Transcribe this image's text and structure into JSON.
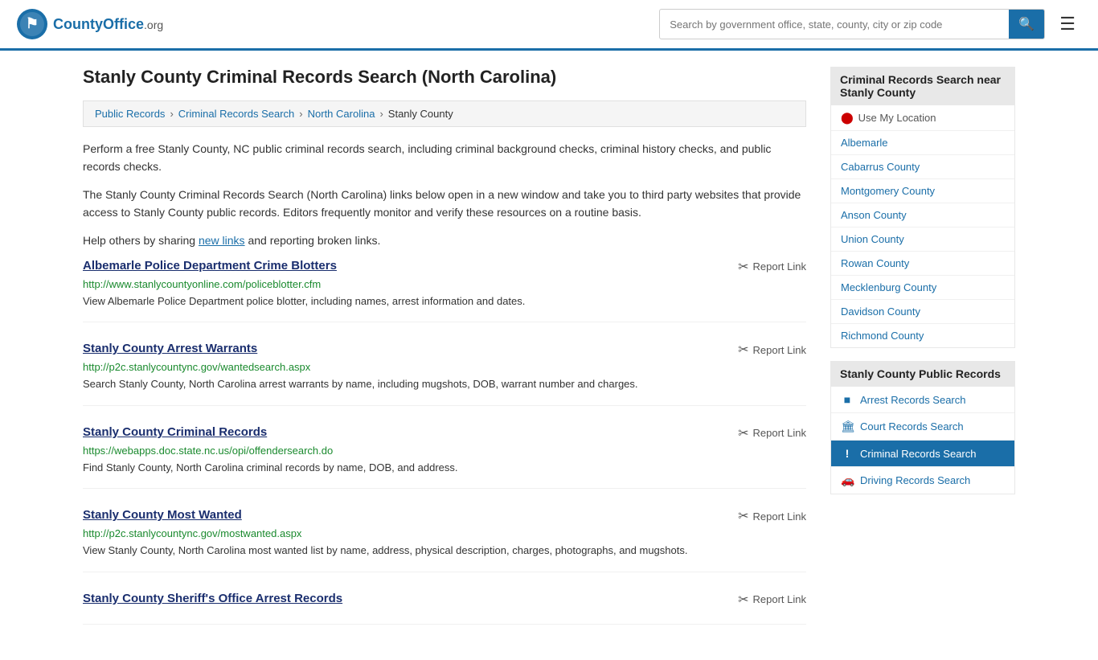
{
  "header": {
    "logo_name": "CountyOffice",
    "logo_suffix": ".org",
    "search_placeholder": "Search by government office, state, county, city or zip code"
  },
  "page": {
    "title": "Stanly County Criminal Records Search (North Carolina)"
  },
  "breadcrumb": {
    "items": [
      {
        "label": "Public Records",
        "href": "#"
      },
      {
        "label": "Criminal Records Search",
        "href": "#"
      },
      {
        "label": "North Carolina",
        "href": "#"
      },
      {
        "label": "Stanly County",
        "href": "#"
      }
    ]
  },
  "description": {
    "para1": "Perform a free Stanly County, NC public criminal records search, including criminal background checks, criminal history checks, and public records checks.",
    "para2": "The Stanly County Criminal Records Search (North Carolina) links below open in a new window and take you to third party websites that provide access to Stanly County public records. Editors frequently monitor and verify these resources on a routine basis.",
    "para3_start": "Help others by sharing ",
    "para3_link": "new links",
    "para3_end": " and reporting broken links."
  },
  "results": [
    {
      "title": "Albemarle Police Department Crime Blotters",
      "url": "http://www.stanlycountyonline.com/policeblotter.cfm",
      "description": "View Albemarle Police Department police blotter, including names, arrest information and dates.",
      "report_label": "Report Link"
    },
    {
      "title": "Stanly County Arrest Warrants",
      "url": "http://p2c.stanlycountync.gov/wantedsearch.aspx",
      "description": "Search Stanly County, North Carolina arrest warrants by name, including mugshots, DOB, warrant number and charges.",
      "report_label": "Report Link"
    },
    {
      "title": "Stanly County Criminal Records",
      "url": "https://webapps.doc.state.nc.us/opi/offendersearch.do",
      "description": "Find Stanly County, North Carolina criminal records by name, DOB, and address.",
      "report_label": "Report Link"
    },
    {
      "title": "Stanly County Most Wanted",
      "url": "http://p2c.stanlycountync.gov/mostwanted.aspx",
      "description": "View Stanly County, North Carolina most wanted list by name, address, physical description, charges, photographs, and mugshots.",
      "report_label": "Report Link"
    },
    {
      "title": "Stanly County Sheriff's Office Arrest Records",
      "url": "",
      "description": "",
      "report_label": "Report Link"
    }
  ],
  "sidebar": {
    "nearby_title": "Criminal Records Search near Stanly County",
    "use_location": "Use My Location",
    "nearby_items": [
      {
        "label": "Albemarle",
        "href": "#"
      },
      {
        "label": "Cabarrus County",
        "href": "#"
      },
      {
        "label": "Montgomery County",
        "href": "#"
      },
      {
        "label": "Anson County",
        "href": "#"
      },
      {
        "label": "Union County",
        "href": "#"
      },
      {
        "label": "Rowan County",
        "href": "#"
      },
      {
        "label": "Mecklenburg County",
        "href": "#"
      },
      {
        "label": "Davidson County",
        "href": "#"
      },
      {
        "label": "Richmond County",
        "href": "#"
      }
    ],
    "public_records_title": "Stanly County Public Records",
    "public_records_items": [
      {
        "label": "Arrest Records Search",
        "icon": "■",
        "active": false
      },
      {
        "label": "Court Records Search",
        "icon": "🏛",
        "active": false
      },
      {
        "label": "Criminal Records Search",
        "icon": "!",
        "active": true
      },
      {
        "label": "Driving Records Search",
        "icon": "🚗",
        "active": false
      }
    ]
  }
}
